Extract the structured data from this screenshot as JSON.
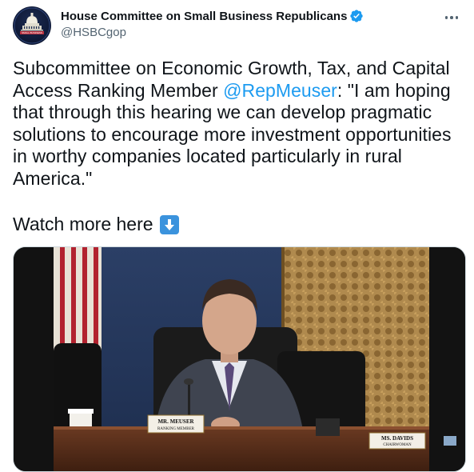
{
  "author": {
    "name": "House Committee on Small Business Republicans",
    "handle": "@HSBCgop",
    "avatar_icon": "capitol-dome-logo",
    "avatar_text": "SMALL BUSINESS",
    "verified_icon": "verified-badge-icon"
  },
  "tweet": {
    "text_before": "Subcommittee on Economic Growth, Tax, and Capital Access Ranking Member ",
    "mention": "@RepMeuser",
    "text_after": ": \"I am hoping that through this hearing we can develop pragmatic solutions to encourage more investment opportunities in worthy companies located particularly in rural America.\"",
    "watch_label": "Watch more here",
    "watch_emoji": "down-arrow-emoji"
  },
  "media": {
    "nameplate_name": "MR. MEUSER",
    "nameplate_title": "RANKING MEMBER",
    "nameplate2_name": "MS. DAVIDS",
    "nameplate2_title": "CHAIRWOMAN"
  },
  "colors": {
    "mention": "#1d9bf0",
    "verified": "#1d9bf0",
    "text": "#0f1419",
    "secondary": "#536471"
  }
}
